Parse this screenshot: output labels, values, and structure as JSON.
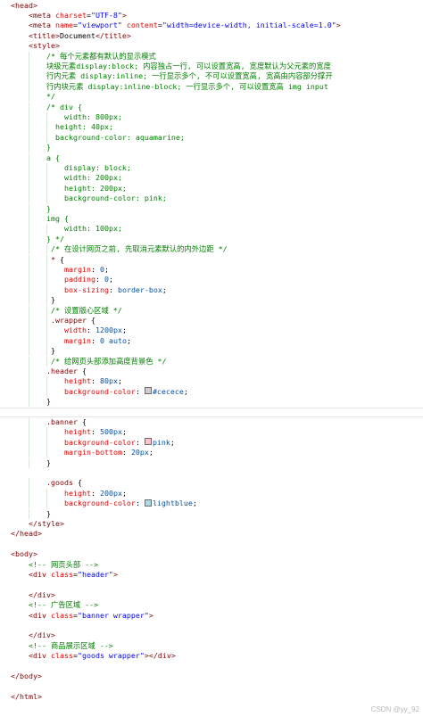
{
  "swatch_colors": {
    "cecece": "#cecece",
    "pink": "#ffc0cb",
    "lightblue": "#add8e6"
  },
  "watermark": "CSDN @yy_92",
  "lines": [
    {
      "indent": 0,
      "segs": [
        [
          "t-tag",
          "<head>"
        ]
      ]
    },
    {
      "indent": 4,
      "segs": [
        [
          "t-tag",
          "<meta "
        ],
        [
          "t-attr",
          "charset"
        ],
        [
          "t-punc",
          "="
        ],
        [
          "t-val",
          "\"UTF-8\""
        ],
        [
          "t-tag",
          ">"
        ]
      ]
    },
    {
      "indent": 4,
      "segs": [
        [
          "t-tag",
          "<meta "
        ],
        [
          "t-attr",
          "name"
        ],
        [
          "t-punc",
          "="
        ],
        [
          "t-val",
          "\"viewport\""
        ],
        [
          "t-attr",
          " content"
        ],
        [
          "t-punc",
          "="
        ],
        [
          "t-val",
          "\"width=device-width, initial-scale=1.0\""
        ],
        [
          "t-tag",
          ">"
        ]
      ]
    },
    {
      "indent": 4,
      "segs": [
        [
          "t-tag",
          "<title>"
        ],
        [
          "t-text",
          "Document"
        ],
        [
          "t-tag",
          "</title>"
        ]
      ]
    },
    {
      "indent": 4,
      "segs": [
        [
          "t-tag",
          "<style>"
        ]
      ]
    },
    {
      "indent": 8,
      "segs": [
        [
          "t-comment",
          "/* 每个元素都有默认的显示模式"
        ]
      ]
    },
    {
      "indent": 8,
      "segs": [
        [
          "t-comment",
          "块级元素display:block; 内容独占一行, 可以设置宽高, 宽度默认为父元素的宽度"
        ]
      ]
    },
    {
      "indent": 8,
      "segs": [
        [
          "t-comment",
          "行内元素 display:inline; 一行显示多个, 不可以设置宽高, 宽高由内容部分撑开"
        ]
      ]
    },
    {
      "indent": 8,
      "segs": [
        [
          "t-comment",
          "行内块元素 display:inline-block; 一行显示多个, 可以设置宽高 img input"
        ]
      ]
    },
    {
      "indent": 8,
      "segs": [
        [
          "t-comment",
          "*/"
        ]
      ]
    },
    {
      "indent": 8,
      "segs": [
        [
          "t-comment",
          "/* div {"
        ]
      ]
    },
    {
      "indent": 12,
      "segs": [
        [
          "t-comment",
          "width: 800px;"
        ]
      ]
    },
    {
      "indent": 10,
      "segs": [
        [
          "t-comment",
          "height: 40px;"
        ]
      ]
    },
    {
      "indent": 10,
      "segs": [
        [
          "t-comment",
          "background-color: aquamarine;"
        ]
      ]
    },
    {
      "indent": 8,
      "segs": [
        [
          "t-comment",
          "}"
        ]
      ]
    },
    {
      "indent": 8,
      "segs": [
        [
          "t-comment",
          "a {"
        ]
      ]
    },
    {
      "indent": 12,
      "segs": [
        [
          "t-comment",
          "display: block;"
        ]
      ]
    },
    {
      "indent": 12,
      "segs": [
        [
          "t-comment",
          "width: 200px;"
        ]
      ]
    },
    {
      "indent": 12,
      "segs": [
        [
          "t-comment",
          "height: 200px;"
        ]
      ]
    },
    {
      "indent": 12,
      "segs": [
        [
          "t-comment",
          "background-color: pink;"
        ]
      ]
    },
    {
      "indent": 8,
      "segs": [
        [
          "t-comment",
          "}"
        ]
      ]
    },
    {
      "indent": 8,
      "segs": [
        [
          "t-comment",
          "img {"
        ]
      ]
    },
    {
      "indent": 12,
      "segs": [
        [
          "t-comment",
          "width: 100px;"
        ]
      ]
    },
    {
      "indent": 8,
      "segs": [
        [
          "t-comment",
          "} */"
        ]
      ]
    },
    {
      "indent": 9,
      "segs": [
        [
          "t-comment",
          "/* 在设计网页之前, 先取消元素默认的内外边距 */"
        ]
      ]
    },
    {
      "indent": 9,
      "segs": [
        [
          "t-sel",
          "* "
        ],
        [
          "t-punc",
          "{"
        ]
      ]
    },
    {
      "indent": 12,
      "segs": [
        [
          "t-prop",
          "margin"
        ],
        [
          "t-punc",
          ": "
        ],
        [
          "t-cval",
          "0"
        ],
        [
          "t-punc",
          ";"
        ]
      ]
    },
    {
      "indent": 12,
      "segs": [
        [
          "t-prop",
          "padding"
        ],
        [
          "t-punc",
          ": "
        ],
        [
          "t-cval",
          "0"
        ],
        [
          "t-punc",
          ";"
        ]
      ]
    },
    {
      "indent": 12,
      "segs": [
        [
          "t-prop",
          "box-sizing"
        ],
        [
          "t-punc",
          ": "
        ],
        [
          "t-cval",
          "border-box"
        ],
        [
          "t-punc",
          ";"
        ]
      ]
    },
    {
      "indent": 9,
      "segs": [
        [
          "t-punc",
          "}"
        ]
      ]
    },
    {
      "indent": 9,
      "segs": [
        [
          "t-comment",
          "/* 设置版心区域 */"
        ]
      ]
    },
    {
      "indent": 9,
      "segs": [
        [
          "t-sel",
          ".wrapper "
        ],
        [
          "t-punc",
          "{"
        ]
      ]
    },
    {
      "indent": 12,
      "segs": [
        [
          "t-prop",
          "width"
        ],
        [
          "t-punc",
          ": "
        ],
        [
          "t-cval",
          "1200px"
        ],
        [
          "t-punc",
          ";"
        ]
      ]
    },
    {
      "indent": 12,
      "segs": [
        [
          "t-prop",
          "margin"
        ],
        [
          "t-punc",
          ": "
        ],
        [
          "t-cval",
          "0 auto"
        ],
        [
          "t-punc",
          ";"
        ]
      ]
    },
    {
      "indent": 9,
      "segs": [
        [
          "t-punc",
          "}"
        ]
      ]
    },
    {
      "indent": 9,
      "segs": [
        [
          "t-comment",
          "/* 给网页头部添加高度背景色 */"
        ]
      ]
    },
    {
      "indent": 8,
      "segs": [
        [
          "t-sel",
          ".header "
        ],
        [
          "t-punc",
          "{"
        ]
      ]
    },
    {
      "indent": 12,
      "segs": [
        [
          "t-prop",
          "height"
        ],
        [
          "t-punc",
          ": "
        ],
        [
          "t-cval",
          "80px"
        ],
        [
          "t-punc",
          ";"
        ]
      ]
    },
    {
      "indent": 12,
      "segs": [
        [
          "t-prop",
          "background-color"
        ],
        [
          "t-punc",
          ": "
        ],
        [
          "swatch",
          "cecece"
        ],
        [
          "t-cval",
          "#cecece"
        ],
        [
          "t-punc",
          ";"
        ]
      ]
    },
    {
      "indent": 8,
      "segs": [
        [
          "t-punc",
          "}"
        ]
      ]
    },
    {
      "indent": 0,
      "segs": [],
      "highlight": true
    },
    {
      "indent": 8,
      "segs": [
        [
          "t-sel",
          ".banner "
        ],
        [
          "t-punc",
          "{"
        ]
      ]
    },
    {
      "indent": 12,
      "segs": [
        [
          "t-prop",
          "height"
        ],
        [
          "t-punc",
          ": "
        ],
        [
          "t-cval",
          "500px"
        ],
        [
          "t-punc",
          ";"
        ]
      ]
    },
    {
      "indent": 12,
      "segs": [
        [
          "t-prop",
          "background-color"
        ],
        [
          "t-punc",
          ": "
        ],
        [
          "swatch",
          "pink"
        ],
        [
          "t-cval",
          "pink"
        ],
        [
          "t-punc",
          ";"
        ]
      ]
    },
    {
      "indent": 12,
      "segs": [
        [
          "t-prop",
          "margin-bottom"
        ],
        [
          "t-punc",
          ": "
        ],
        [
          "t-cval",
          "20px"
        ],
        [
          "t-punc",
          ";"
        ]
      ]
    },
    {
      "indent": 8,
      "segs": [
        [
          "t-punc",
          "}"
        ]
      ]
    },
    {
      "indent": 0,
      "segs": []
    },
    {
      "indent": 8,
      "segs": [
        [
          "t-sel",
          ".goods "
        ],
        [
          "t-punc",
          "{"
        ]
      ]
    },
    {
      "indent": 12,
      "segs": [
        [
          "t-prop",
          "height"
        ],
        [
          "t-punc",
          ": "
        ],
        [
          "t-cval",
          "200px"
        ],
        [
          "t-punc",
          ";"
        ]
      ]
    },
    {
      "indent": 12,
      "segs": [
        [
          "t-prop",
          "background-color"
        ],
        [
          "t-punc",
          ": "
        ],
        [
          "swatch",
          "lightblue"
        ],
        [
          "t-cval",
          "lightblue"
        ],
        [
          "t-punc",
          ";"
        ]
      ]
    },
    {
      "indent": 8,
      "segs": [
        [
          "t-punc",
          "}"
        ]
      ]
    },
    {
      "indent": 4,
      "segs": [
        [
          "t-tag",
          "</style>"
        ]
      ]
    },
    {
      "indent": 0,
      "segs": [
        [
          "t-tag",
          "</head>"
        ]
      ]
    },
    {
      "indent": 0,
      "segs": []
    },
    {
      "indent": 0,
      "segs": [
        [
          "t-tag",
          "<body>"
        ]
      ]
    },
    {
      "indent": 4,
      "segs": [
        [
          "t-comment",
          "<!-- 网页头部 -->"
        ]
      ]
    },
    {
      "indent": 4,
      "segs": [
        [
          "t-tag",
          "<div "
        ],
        [
          "t-attr",
          "class"
        ],
        [
          "t-punc",
          "="
        ],
        [
          "t-val",
          "\"header\""
        ],
        [
          "t-tag",
          ">"
        ]
      ]
    },
    {
      "indent": 0,
      "segs": []
    },
    {
      "indent": 4,
      "segs": [
        [
          "t-tag",
          "</div>"
        ]
      ]
    },
    {
      "indent": 4,
      "segs": [
        [
          "t-comment",
          "<!-- 广告区域 -->"
        ]
      ]
    },
    {
      "indent": 4,
      "segs": [
        [
          "t-tag",
          "<div "
        ],
        [
          "t-attr",
          "class"
        ],
        [
          "t-punc",
          "="
        ],
        [
          "t-val",
          "\"banner wrapper\""
        ],
        [
          "t-tag",
          ">"
        ]
      ]
    },
    {
      "indent": 0,
      "segs": []
    },
    {
      "indent": 4,
      "segs": [
        [
          "t-tag",
          "</div>"
        ]
      ]
    },
    {
      "indent": 4,
      "segs": [
        [
          "t-comment",
          "<!-- 商品展示区域 -->"
        ]
      ]
    },
    {
      "indent": 4,
      "segs": [
        [
          "t-tag",
          "<div "
        ],
        [
          "t-attr",
          "class"
        ],
        [
          "t-punc",
          "="
        ],
        [
          "t-val",
          "\"goods wrapper\""
        ],
        [
          "t-tag",
          "></div>"
        ]
      ]
    },
    {
      "indent": 0,
      "segs": []
    },
    {
      "indent": 0,
      "segs": [
        [
          "t-tag",
          "</body>"
        ]
      ]
    },
    {
      "indent": 0,
      "segs": []
    },
    {
      "indent": 0,
      "segs": [
        [
          "t-tag",
          "</html>"
        ]
      ]
    }
  ]
}
